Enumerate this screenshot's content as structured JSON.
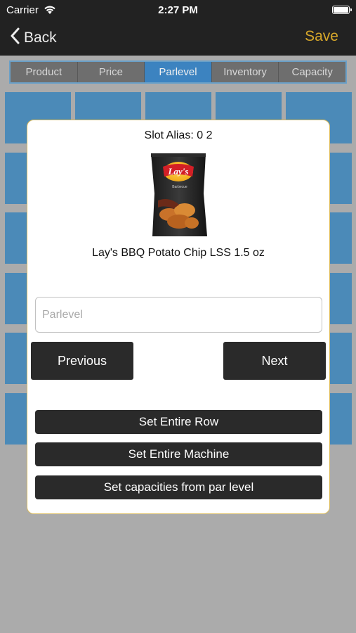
{
  "status_bar": {
    "carrier": "Carrier",
    "time": "2:27 PM"
  },
  "nav": {
    "back_label": "Back",
    "save_label": "Save",
    "accent_color": "#d6a72a"
  },
  "tabs": [
    {
      "label": "Product",
      "active": false
    },
    {
      "label": "Price",
      "active": false
    },
    {
      "label": "Parlevel",
      "active": true
    },
    {
      "label": "Inventory",
      "active": false
    },
    {
      "label": "Capacity",
      "active": false
    }
  ],
  "modal": {
    "slot_alias": "Slot Alias: 0 2",
    "product_image_icon": "lays-bbq-chip-bag",
    "product_name": "Lay's BBQ Potato Chip LSS 1.5 oz",
    "parlevel_input": {
      "value": "",
      "placeholder": "Parlevel"
    },
    "previous_label": "Previous",
    "next_label": "Next",
    "set_row_label": "Set Entire Row",
    "set_machine_label": "Set Entire Machine",
    "set_capacities_label": "Set capacities from par level"
  },
  "colors": {
    "active_tab": "#3c83c0",
    "grid_cell": "#4b8ab8",
    "button": "#2a2a2a"
  }
}
